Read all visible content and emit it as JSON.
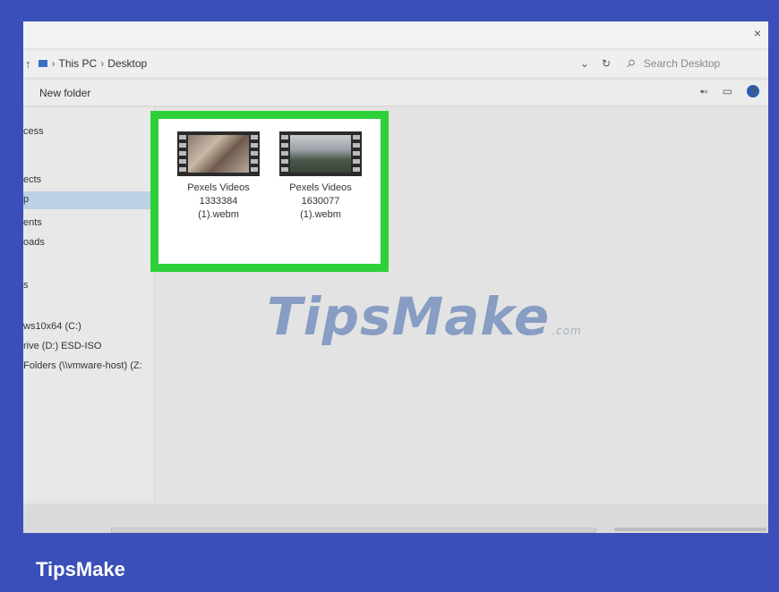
{
  "window": {
    "close_glyph": "×"
  },
  "address": {
    "up_icon": "up-arrow-icon",
    "folder_icon": "folder-icon",
    "crumbs": [
      "This PC",
      "Desktop"
    ],
    "separator": "›",
    "dropdown_glyph": "⌄",
    "refresh_glyph": "↻",
    "search_placeholder": "Search Desktop"
  },
  "toolbar": {
    "new_folder": "New folder",
    "view_glyph": "▪▫",
    "pane_glyph": "▭",
    "help_glyph": "?"
  },
  "sidebar": {
    "items": [
      {
        "label": "cess",
        "selected": false
      },
      {
        "label": "ects",
        "selected": false
      },
      {
        "label": "p",
        "selected": true
      },
      {
        "label": "ents",
        "selected": false
      },
      {
        "label": "oads",
        "selected": false
      },
      {
        "label": "s",
        "selected": false
      },
      {
        "label": "ws10x64 (C:)",
        "selected": false
      },
      {
        "label": "rive (D:) ESD-ISO",
        "selected": false
      },
      {
        "label": " Folders (\\\\vmware-host) (Z:",
        "selected": false
      }
    ]
  },
  "files": [
    {
      "line1": "Pexels Videos",
      "line2": "1333384",
      "line3": "(1).webm"
    },
    {
      "line1": "Pexels Videos",
      "line2": "1630077",
      "line3": "(1).webm"
    }
  ],
  "watermark": {
    "text": "TipsMake",
    "suffix": ".com"
  },
  "brand": {
    "text": "TipsMake"
  },
  "colors": {
    "frame_bg": "#3a4fb8",
    "highlight": "#2ed03a"
  }
}
